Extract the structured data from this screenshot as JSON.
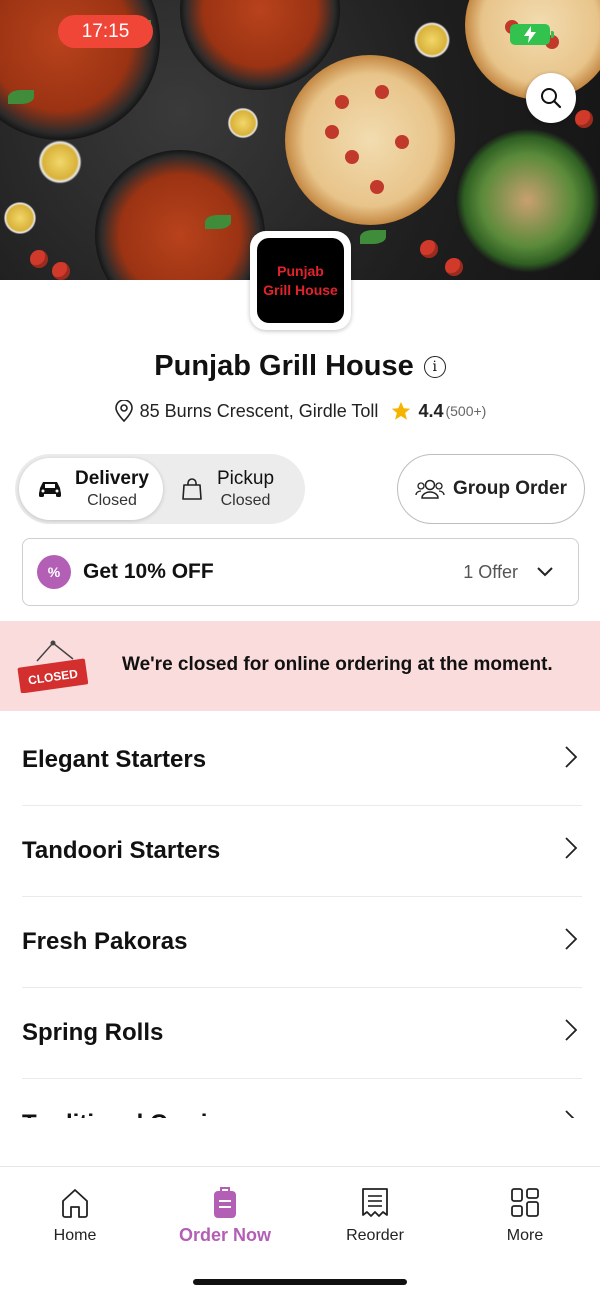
{
  "status_bar": {
    "time": "17:15"
  },
  "restaurant": {
    "logo_line1": "Punjab",
    "logo_line2": "Grill House",
    "name": "Punjab Grill House",
    "address": "85 Burns Crescent, Girdle Toll",
    "rating": "4.4",
    "rating_count": "(500+)"
  },
  "order_mode": {
    "delivery": {
      "label": "Delivery",
      "status": "Closed",
      "selected": true
    },
    "pickup": {
      "label": "Pickup",
      "status": "Closed",
      "selected": false
    },
    "group_order_label": "Group Order"
  },
  "offer": {
    "title": "Get 10% OFF",
    "count": "1 Offer",
    "badge": "%"
  },
  "closed_banner": {
    "tag": "CLOSED",
    "message": "We're closed for online ordering at the moment."
  },
  "categories": [
    {
      "label": "Elegant Starters"
    },
    {
      "label": "Tandoori Starters"
    },
    {
      "label": "Fresh Pakoras"
    },
    {
      "label": "Spring Rolls"
    },
    {
      "label": "Traditional Curries"
    }
  ],
  "bottom_nav": [
    {
      "label": "Home",
      "icon": "home-icon",
      "active": false
    },
    {
      "label": "Order Now",
      "icon": "order-icon",
      "active": true
    },
    {
      "label": "Reorder",
      "icon": "receipt-icon",
      "active": false
    },
    {
      "label": "More",
      "icon": "grid-icon",
      "active": false
    }
  ],
  "colors": {
    "accent": "#b25fb5",
    "status_time_bg": "#f04638",
    "closed_banner_bg": "#fbdcdc",
    "logo_text": "#e3232b"
  }
}
